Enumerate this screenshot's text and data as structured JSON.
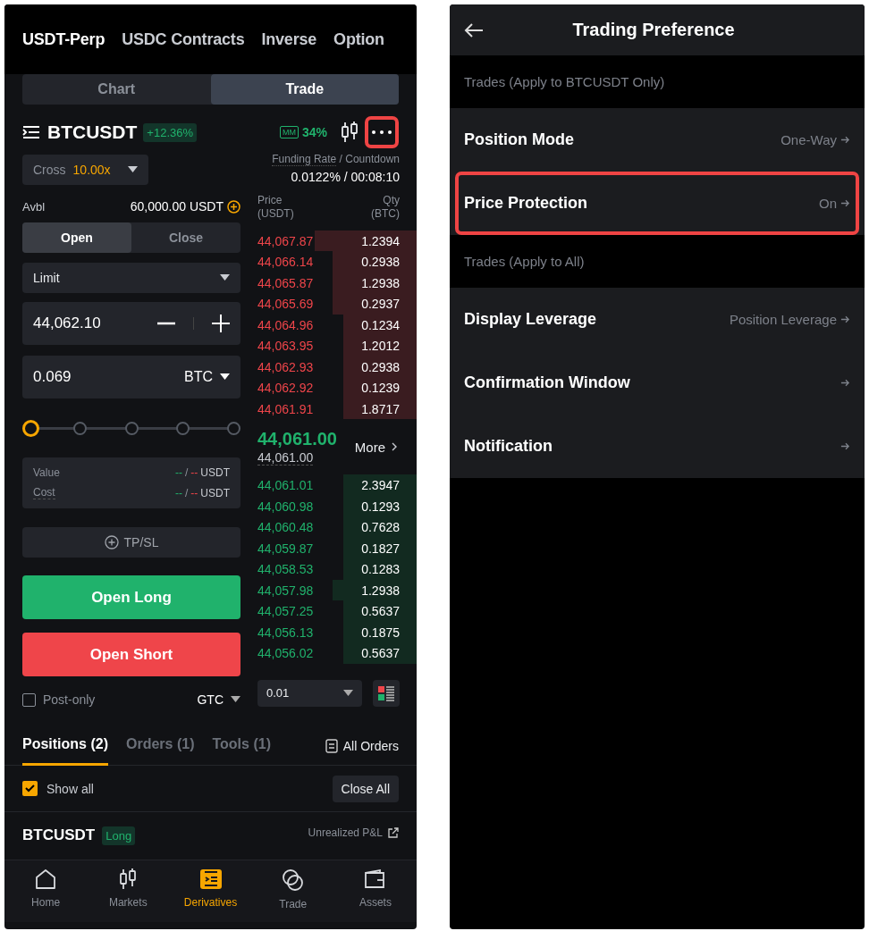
{
  "market_tabs": [
    {
      "label": "USDT-Perp",
      "selected": true
    },
    {
      "label": "USDC Contracts",
      "selected": false
    },
    {
      "label": "Inverse",
      "selected": false
    },
    {
      "label": "Option",
      "selected": false
    }
  ],
  "view_tabs": [
    {
      "label": "Chart",
      "selected": false
    },
    {
      "label": "Trade",
      "selected": true
    }
  ],
  "symbol": {
    "name": "BTCUSDT",
    "change": "+12.36%",
    "mm_label": "MM",
    "mm_value": "34%",
    "more_highlighted": true
  },
  "margin": {
    "mode": "Cross",
    "leverage": "10.00x"
  },
  "available": {
    "label": "Avbl",
    "value": "60,000.00 USDT"
  },
  "side_tabs": [
    {
      "label": "Open",
      "selected": true
    },
    {
      "label": "Close",
      "selected": false
    }
  ],
  "order_type": "Limit",
  "price": {
    "value": "44,062.10"
  },
  "quantity": {
    "value": "0.069",
    "unit": "BTC"
  },
  "slider": {
    "level": 0
  },
  "summary": [
    {
      "label": "Value",
      "long": "--",
      "separator": "/",
      "short": "--",
      "unit": "USDT"
    },
    {
      "label": "Cost",
      "long": "--",
      "separator": "/",
      "short": "--",
      "unit": "USDT"
    }
  ],
  "tpsl": "TP/SL",
  "buttons": [
    {
      "label": "Open Long",
      "kind": "long"
    },
    {
      "label": "Open Short",
      "kind": "short"
    }
  ],
  "post_only": {
    "label": "Post-only",
    "checked": false
  },
  "time_in_force": "GTC",
  "funding": {
    "label": "Funding Rate",
    "sub_label": "/ Countdown",
    "value": "0.0122% / 00:08:10"
  },
  "book": {
    "price_label": "Price",
    "price_unit": "(USDT)",
    "qty_label": "Qty",
    "qty_unit": "(BTC)",
    "asks": [
      {
        "price": "44,067.87",
        "qty": "1.2394"
      },
      {
        "price": "44,066.14",
        "qty": "0.2938"
      },
      {
        "price": "44,065.87",
        "qty": "1.2938"
      },
      {
        "price": "44,065.69",
        "qty": "0.2937"
      },
      {
        "price": "44,064.96",
        "qty": "0.1234"
      },
      {
        "price": "44,063.95",
        "qty": "1.2012"
      },
      {
        "price": "44,062.93",
        "qty": "0.2938"
      },
      {
        "price": "44,062.92",
        "qty": "0.1239"
      },
      {
        "price": "44,061.91",
        "qty": "1.8717"
      }
    ],
    "last_price": "44,061.00",
    "mark_price": "44,061.00",
    "more": "More",
    "bids": [
      {
        "price": "44,061.01",
        "qty": "2.3947"
      },
      {
        "price": "44,060.98",
        "qty": "0.1293"
      },
      {
        "price": "44,060.48",
        "qty": "0.7628"
      },
      {
        "price": "44,059.87",
        "qty": "0.1827"
      },
      {
        "price": "44,058.53",
        "qty": "0.1283"
      },
      {
        "price": "44,057.98",
        "qty": "1.2938"
      },
      {
        "price": "44,057.25",
        "qty": "0.5637"
      },
      {
        "price": "44,056.13",
        "qty": "0.1875"
      },
      {
        "price": "44,056.02",
        "qty": "0.5637"
      }
    ],
    "tick": "0.01"
  },
  "position_tabs": [
    {
      "label": "Positions (2)",
      "selected": true
    },
    {
      "label": "Orders (1)",
      "selected": false
    },
    {
      "label": "Tools (1)",
      "selected": false
    }
  ],
  "all_orders": "All Orders",
  "show_all": {
    "label": "Show all",
    "checked": true
  },
  "close_all": "Close All",
  "position": {
    "symbol": "BTCUSDT",
    "side": "Long",
    "pnl_label": "Unrealized P&L"
  },
  "nav": [
    {
      "label": "Home",
      "selected": false
    },
    {
      "label": "Markets",
      "selected": false
    },
    {
      "label": "Derivatives",
      "selected": true
    },
    {
      "label": "Trade",
      "selected": false
    },
    {
      "label": "Assets",
      "selected": false
    }
  ],
  "preferences": {
    "title": "Trading Preference",
    "sections": [
      {
        "heading": "Trades (Apply to BTCUSDT Only)",
        "items": [
          {
            "label": "Position Mode",
            "value": "One-Way",
            "highlighted": false
          },
          {
            "label": "Price Protection",
            "value": "On",
            "highlighted": true
          }
        ]
      },
      {
        "heading": "Trades (Apply to All)",
        "items": [
          {
            "label": "Display Leverage",
            "value": "Position Leverage",
            "highlighted": false
          },
          {
            "label": "Confirmation Window",
            "highlighted": false
          },
          {
            "label": "Notification",
            "highlighted": false
          }
        ]
      }
    ]
  }
}
